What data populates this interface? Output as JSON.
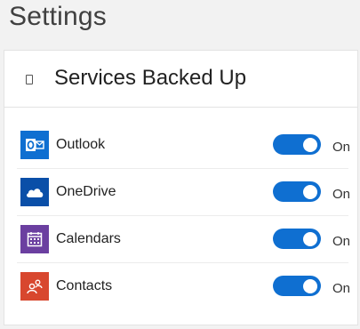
{
  "page": {
    "title": "Settings"
  },
  "card": {
    "header_title": "Services Backed Up"
  },
  "services": [
    {
      "label": "Outlook",
      "icon": "outlook-icon",
      "color": "#0f6fd1",
      "enabled": true,
      "state_label": "On"
    },
    {
      "label": "OneDrive",
      "icon": "onedrive-icon",
      "color": "#0a4fa8",
      "enabled": true,
      "state_label": "On"
    },
    {
      "label": "Calendars",
      "icon": "calendar-icon",
      "color": "#6b3fa0",
      "enabled": true,
      "state_label": "On"
    },
    {
      "label": "Contacts",
      "icon": "contacts-icon",
      "color": "#d8472e",
      "enabled": true,
      "state_label": "On"
    }
  ],
  "colors": {
    "toggle_on": "#0f6fd1",
    "background": "#f2f2f2",
    "card": "#ffffff"
  }
}
